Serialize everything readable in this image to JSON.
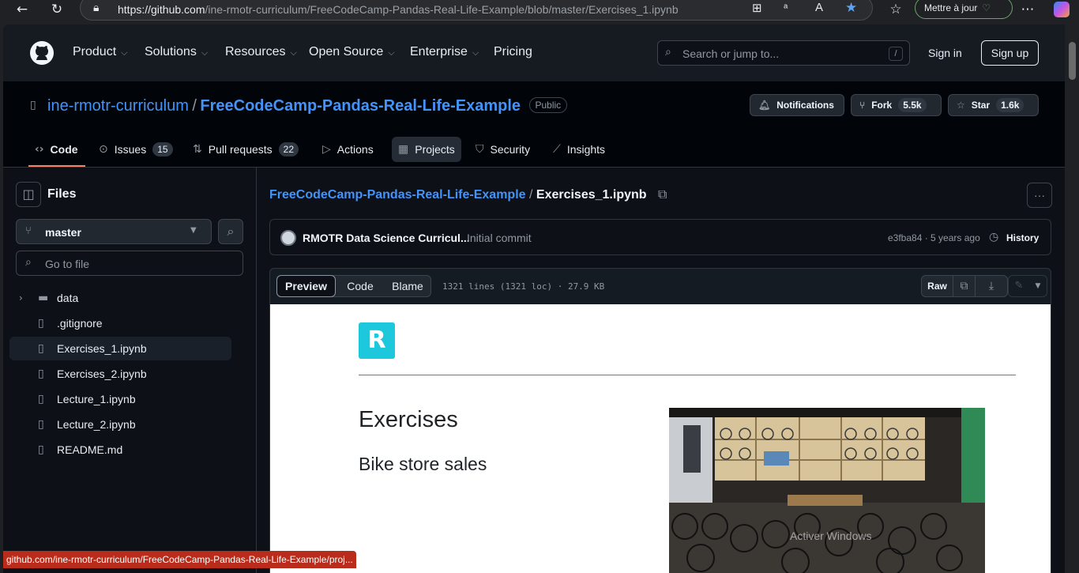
{
  "browser": {
    "url_host": "https://github.com",
    "url_path": "/ine-rmotr-curriculum/FreeCodeCamp-Pandas-Real-Life-Example/blob/master/Exercises_1.ipynb",
    "update_label": "Mettre à jour",
    "icons": [
      "back-arrow",
      "reload",
      "lock",
      "apps",
      "read-aloud",
      "text-size",
      "favorite-star",
      "favorites",
      "more",
      "copilot"
    ]
  },
  "header": {
    "nav": [
      "Product",
      "Solutions",
      "Resources",
      "Open Source",
      "Enterprise",
      "Pricing"
    ],
    "search_placeholder": "Search or jump to...",
    "search_key": "/",
    "sign_in": "Sign in",
    "sign_up": "Sign up"
  },
  "repo": {
    "owner": "ine-rmotr-curriculum",
    "separator": "/",
    "name": "FreeCodeCamp-Pandas-Real-Life-Example",
    "visibility": "Public",
    "notifications": "Notifications",
    "fork_label": "Fork",
    "fork_count": "5.5k",
    "star_label": "Star",
    "star_count": "1.6k",
    "tabs": [
      {
        "label": "Code",
        "count": ""
      },
      {
        "label": "Issues",
        "count": "15"
      },
      {
        "label": "Pull requests",
        "count": "22"
      },
      {
        "label": "Actions",
        "count": ""
      },
      {
        "label": "Projects",
        "count": ""
      },
      {
        "label": "Security",
        "count": ""
      },
      {
        "label": "Insights",
        "count": ""
      }
    ]
  },
  "sidebar": {
    "title": "Files",
    "branch": "master",
    "goto_placeholder": "Go to file",
    "items": [
      "data",
      ".gitignore",
      "Exercises_1.ipynb",
      "Exercises_2.ipynb",
      "Lecture_1.ipynb",
      "Lecture_2.ipynb",
      "README.md"
    ],
    "active_item": "Exercises_1.ipynb"
  },
  "file": {
    "breadcrumb_repo": "FreeCodeCamp-Pandas-Real-Life-Example",
    "breadcrumb_sep": "/",
    "breadcrumb_file": "Exercises_1.ipynb",
    "commit_author": "RMOTR Data Science Curricul...",
    "commit_message": "Initial commit",
    "commit_meta": "e3fba84 · 5 years ago",
    "history": "History",
    "view_tabs": [
      "Preview",
      "Code",
      "Blame"
    ],
    "file_info": "1321 lines (1321 loc) · 27.9 KB",
    "raw": "Raw"
  },
  "notebook": {
    "logo_letter": "R",
    "heading": "Exercises",
    "subheading": "Bike store sales"
  },
  "status_url": "github.com/ine-rmotr-curriculum/FreeCodeCamp-Pandas-Real-Life-Example/proj...",
  "watermark": "Activer Windows",
  "colors": {
    "link": "#4493f8",
    "bg": "#0d1117",
    "logo": "#1dc8dc",
    "status": "#b92b1a"
  }
}
